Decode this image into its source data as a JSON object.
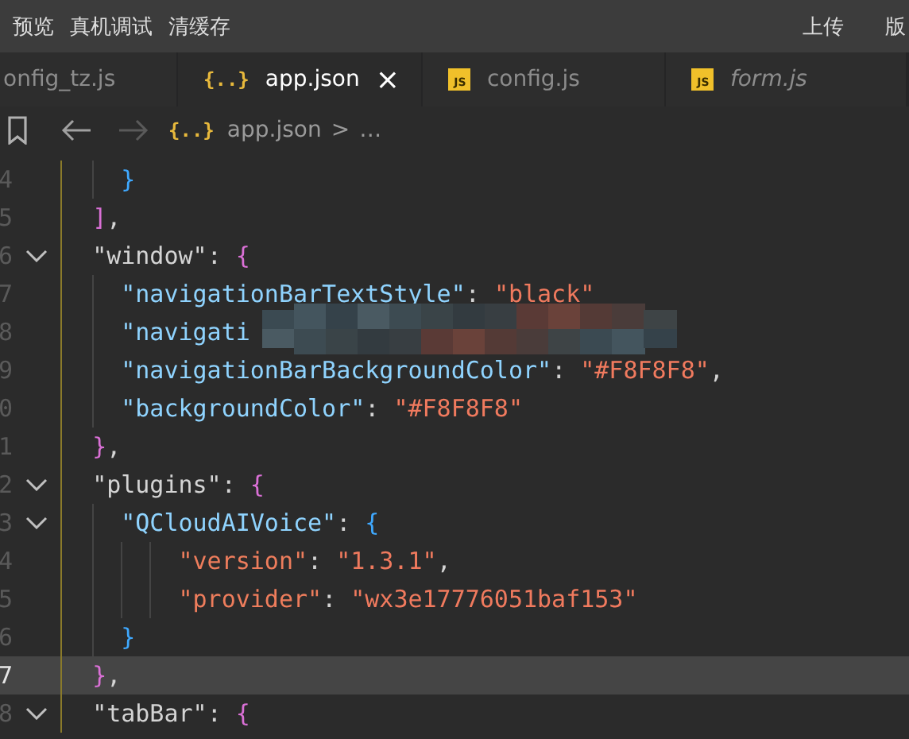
{
  "toolbar": {
    "left": [
      "预览",
      "真机调试",
      "清缓存"
    ],
    "right": [
      "上传",
      "版"
    ]
  },
  "tabs": [
    {
      "label": "onfig_tz.js",
      "selected": false,
      "preview": false
    },
    {
      "label": "app.json",
      "icon": {
        "kind": "json",
        "text": "{..}"
      },
      "selected": true,
      "preview": false,
      "close": "×"
    },
    {
      "label": "config.js",
      "icon": {
        "kind": "js",
        "text": "JS"
      },
      "selected": false,
      "preview": false
    },
    {
      "label": "form.js",
      "icon": {
        "kind": "js",
        "text": "JS"
      },
      "selected": false,
      "preview": true
    }
  ],
  "breadcrumb": {
    "icon": {
      "kind": "json",
      "text": "{..}"
    },
    "file": "app.json",
    "separator": ">",
    "rest": "…"
  },
  "lines": [
    {
      "number": "4",
      "current": false,
      "tokens": [
        {
          "kind": "brace-blue",
          "text": "}"
        }
      ]
    },
    {
      "number": "5",
      "current": false,
      "tokens": [
        {
          "kind": "brace-pink",
          "text": "]"
        },
        {
          "kind": "punct",
          "text": ","
        }
      ]
    },
    {
      "number": "6",
      "current": false,
      "fold": {
        "expanded": true
      },
      "tokens": [
        {
          "kind": "key1",
          "text": "\"window\""
        },
        {
          "kind": "punct",
          "text": ": "
        },
        {
          "kind": "brace-pink",
          "text": "{"
        }
      ]
    },
    {
      "number": "7",
      "current": false,
      "tokens": [
        {
          "kind": "key2",
          "text": "\"navigationBarTextStyle\""
        },
        {
          "kind": "punct",
          "text": ": "
        },
        {
          "kind": "string",
          "text": "\"black\""
        }
      ]
    },
    {
      "number": "8",
      "current": false,
      "tokens": [
        {
          "kind": "key2",
          "text": "\"navigati"
        }
      ]
    },
    {
      "number": "9",
      "current": false,
      "tokens": [
        {
          "kind": "key2",
          "text": "\"navigationBarBackgroundColor\""
        },
        {
          "kind": "punct",
          "text": ": "
        },
        {
          "kind": "string",
          "text": "\"#F8F8F8\""
        },
        {
          "kind": "punct",
          "text": ","
        }
      ]
    },
    {
      "number": "0",
      "current": false,
      "tokens": [
        {
          "kind": "key2",
          "text": "\"backgroundColor\""
        },
        {
          "kind": "punct",
          "text": ": "
        },
        {
          "kind": "string",
          "text": "\"#F8F8F8\""
        }
      ]
    },
    {
      "number": "1",
      "current": false,
      "tokens": [
        {
          "kind": "brace-pink",
          "text": "}"
        },
        {
          "kind": "punct",
          "text": ","
        }
      ]
    },
    {
      "number": "2",
      "current": false,
      "fold": {
        "expanded": true
      },
      "tokens": [
        {
          "kind": "key1",
          "text": "\"plugins\""
        },
        {
          "kind": "punct",
          "text": ": "
        },
        {
          "kind": "brace-pink",
          "text": "{"
        }
      ]
    },
    {
      "number": "3",
      "current": false,
      "fold": {
        "expanded": true
      },
      "tokens": [
        {
          "kind": "key2",
          "text": "\"QCloudAIVoice\""
        },
        {
          "kind": "punct",
          "text": ": "
        },
        {
          "kind": "brace-blue",
          "text": "{"
        }
      ]
    },
    {
      "number": "4",
      "current": false,
      "tokens": [
        {
          "kind": "key3",
          "text": "\"version\""
        },
        {
          "kind": "punct",
          "text": ": "
        },
        {
          "kind": "string",
          "text": "\"1.3.1\""
        },
        {
          "kind": "punct",
          "text": ","
        }
      ]
    },
    {
      "number": "5",
      "current": false,
      "tokens": [
        {
          "kind": "key3",
          "text": "\"provider\""
        },
        {
          "kind": "punct",
          "text": ": "
        },
        {
          "kind": "string",
          "text": "\"wx3e17776051baf153\""
        }
      ]
    },
    {
      "number": "6",
      "current": false,
      "tokens": [
        {
          "kind": "brace-blue",
          "text": "}"
        }
      ]
    },
    {
      "number": "7",
      "current": true,
      "tokens": [
        {
          "kind": "brace-pink",
          "text": "}"
        },
        {
          "kind": "punct",
          "text": ","
        }
      ]
    },
    {
      "number": "8",
      "current": false,
      "fold": {
        "expanded": true
      },
      "tokens": [
        {
          "kind": "key1",
          "text": "\"tabBar\""
        },
        {
          "kind": "punct",
          "text": ": "
        },
        {
          "kind": "brace-pink",
          "text": "{"
        }
      ]
    }
  ],
  "redaction": {
    "kind": "pixelated"
  }
}
